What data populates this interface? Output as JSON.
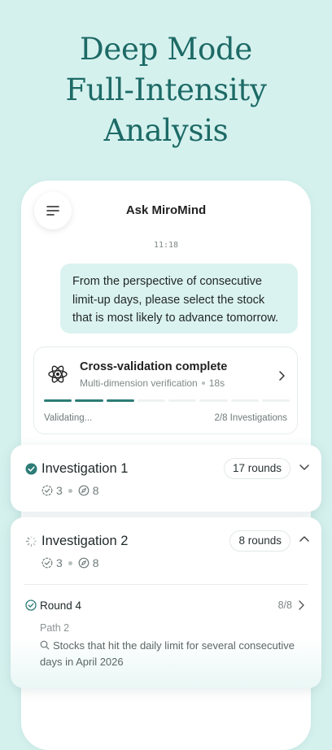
{
  "headline": {
    "line1": "Deep Mode",
    "line2": "Full-Intensity",
    "line3": "Analysis"
  },
  "app": {
    "title": "Ask MiroMind",
    "time": "11:18"
  },
  "message": {
    "line1": "From the perspective of consecutive",
    "line2": "limit-up days, please select the stock",
    "line3": "that is most likely to advance tomorrow."
  },
  "cross_validation": {
    "title": "Cross-validation complete",
    "subtitle": "Multi-dimension verification",
    "duration": "18s",
    "status": "Validating...",
    "count": "2/8 Investigations",
    "progress_done": 3,
    "progress_total": 8
  },
  "investigations": [
    {
      "title": "Investigation 1",
      "rounds": "17 rounds",
      "checks": "3",
      "explores": "8",
      "state": "complete",
      "expanded": false
    },
    {
      "title": "Investigation 2",
      "rounds": "8 rounds",
      "checks": "3",
      "explores": "8",
      "state": "running",
      "expanded": true,
      "round": {
        "title": "Round 4",
        "count": "8/8",
        "path": "Path 2",
        "query": "Stocks that hit the daily limit for several consecutive days in April 2026"
      }
    }
  ],
  "icons": {
    "menu": "menu-icon",
    "atom": "atom-icon",
    "chevron_right": "chevron-right-icon",
    "chevron_down": "chevron-down-icon",
    "chevron_up": "chevron-up-icon",
    "check_circle": "check-circle-icon",
    "spinner": "spinner-icon",
    "verified": "verified-badge-icon",
    "compass": "compass-icon",
    "search": "search-icon"
  },
  "colors": {
    "background": "#d5f1ee",
    "accent": "#1d6a66",
    "progress": "#2d7c76",
    "bubble": "#dbf3f0"
  }
}
